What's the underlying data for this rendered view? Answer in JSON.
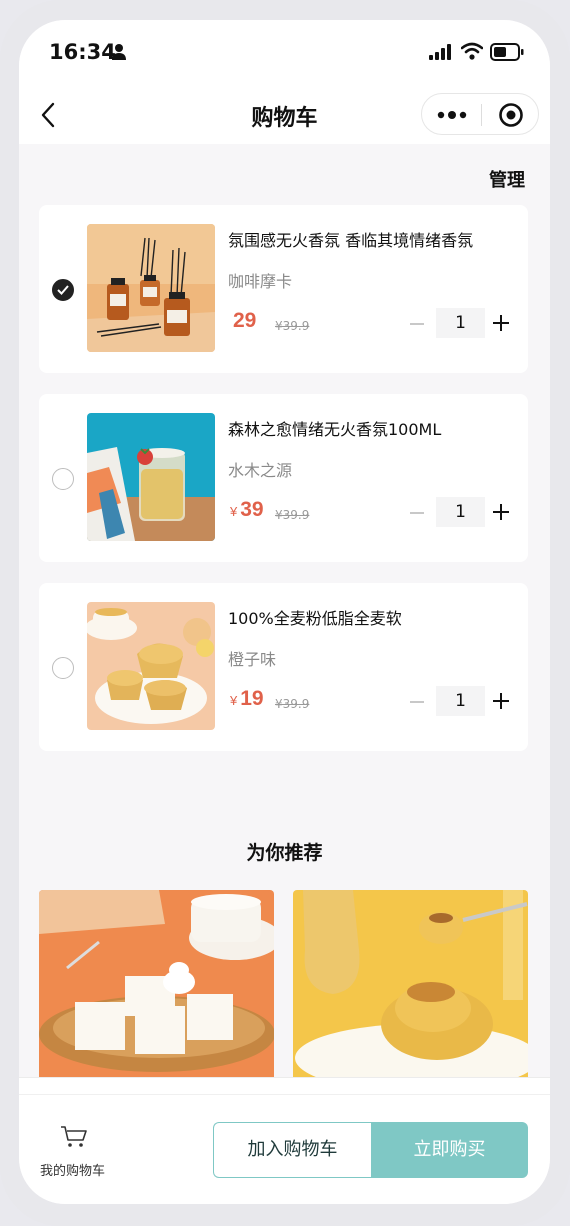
{
  "status_bar": {
    "time": "16:34"
  },
  "nav": {
    "title": "购物车"
  },
  "manage_label": "管理",
  "cart_items": [
    {
      "name": "氛围感无火香氛 香临其境情绪香氛",
      "variant": "咖啡摩卡",
      "currency": "",
      "price": "29",
      "old_price": "¥39.9",
      "quantity": "1",
      "selected": true
    },
    {
      "name": "森林之愈情绪无火香氛100ML",
      "variant": "水木之源",
      "currency": "¥",
      "price": "39",
      "old_price": "¥39.9",
      "quantity": "1",
      "selected": false
    },
    {
      "name": "100%全麦粉低脂全麦软",
      "variant": "橙子味",
      "currency": "¥",
      "price": "19",
      "old_price": "¥39.9",
      "quantity": "1",
      "selected": false
    }
  ],
  "recommend": {
    "title": "为你推荐"
  },
  "bottom": {
    "cart_label": "我的购物车",
    "add_to_cart": "加入购物车",
    "buy_now": "立即购买"
  },
  "colors": {
    "accent": "#7fc8c5",
    "price": "#e0614a"
  }
}
